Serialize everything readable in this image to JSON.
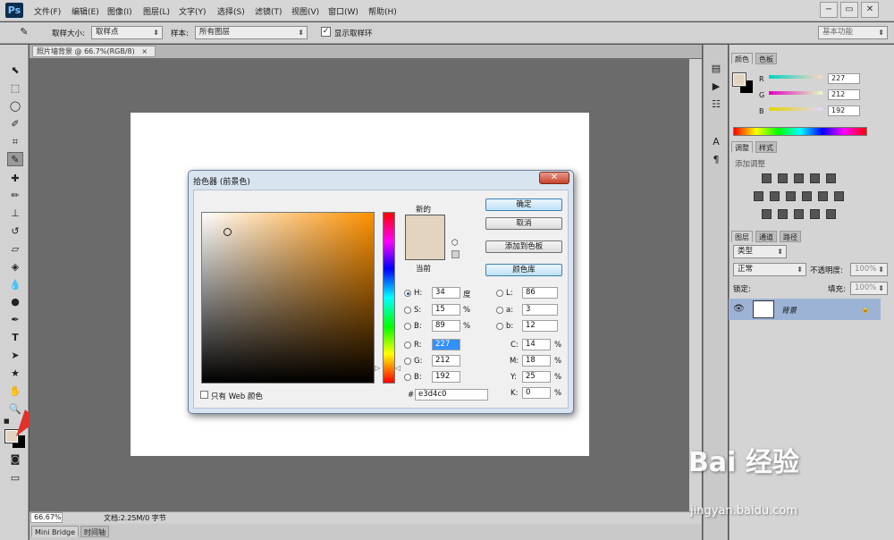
{
  "app": {
    "logo": "Ps",
    "workspace": "基本功能"
  },
  "menu": [
    "文件(F)",
    "编辑(E)",
    "图像(I)",
    "图层(L)",
    "文字(Y)",
    "选择(S)",
    "滤镜(T)",
    "视图(V)",
    "窗口(W)",
    "帮助(H)"
  ],
  "window_buttons": [
    "−",
    "▭",
    "✕"
  ],
  "options": {
    "sample_size_label": "取样大小:",
    "sample_size_value": "取样点",
    "sample_label": "样本:",
    "sample_value": "所有图层",
    "show_ring_label": "显示取样环"
  },
  "document": {
    "tab_title": "照片墙背景 @ 66.7%(RGB/8)",
    "tab_close": "×",
    "zoom": "66.67%",
    "doc_info": "文档:2.25M/0 字节"
  },
  "bottom_tabs": [
    "Mini Bridge",
    "时间轴"
  ],
  "color_panel": {
    "tabs": [
      "颜色",
      "色板"
    ],
    "r_label": "R",
    "g_label": "G",
    "b_label": "B",
    "r": "227",
    "g": "212",
    "b": "192"
  },
  "adjust_panel": {
    "tabs": [
      "调整",
      "样式"
    ],
    "title": "添加调整"
  },
  "layers_panel": {
    "tabs": [
      "图层",
      "通道",
      "路径"
    ],
    "filter": "类型",
    "blend": "正常",
    "opacity_label": "不透明度:",
    "opacity": "100%",
    "lock_label": "锁定:",
    "fill_label": "填充:",
    "fill": "100%",
    "layer_name": "背景"
  },
  "dialog": {
    "title": "拾色器 (前景色)",
    "close": "✕",
    "new_label": "新的",
    "current_label": "当前",
    "ok": "确定",
    "cancel": "取消",
    "add_swatch": "添加到色板",
    "color_lib": "颜色库",
    "web_only": "只有 Web 颜色",
    "h_label": "H:",
    "h": "34",
    "h_unit": "度",
    "s_label": "S:",
    "s": "15",
    "s_unit": "%",
    "bb_label": "B:",
    "bb": "89",
    "bb_unit": "%",
    "r_label": "R:",
    "r": "227",
    "g_label": "G:",
    "g": "212",
    "b_label": "B:",
    "b": "192",
    "l_label": "L:",
    "l": "86",
    "a_label": "a:",
    "a": "3",
    "lab_b_label": "b:",
    "lab_b": "12",
    "c_label": "C:",
    "c": "14",
    "m_label": "M:",
    "m": "18",
    "y_label": "Y:",
    "y": "25",
    "k_label": "K:",
    "k": "0",
    "cmyk_unit": "%",
    "hex_label": "#",
    "hex": "e3d4c0",
    "color": "#e3d4c0"
  },
  "watermark": {
    "brand": "Bai 经验",
    "url": "jingyan.baidu.com"
  }
}
